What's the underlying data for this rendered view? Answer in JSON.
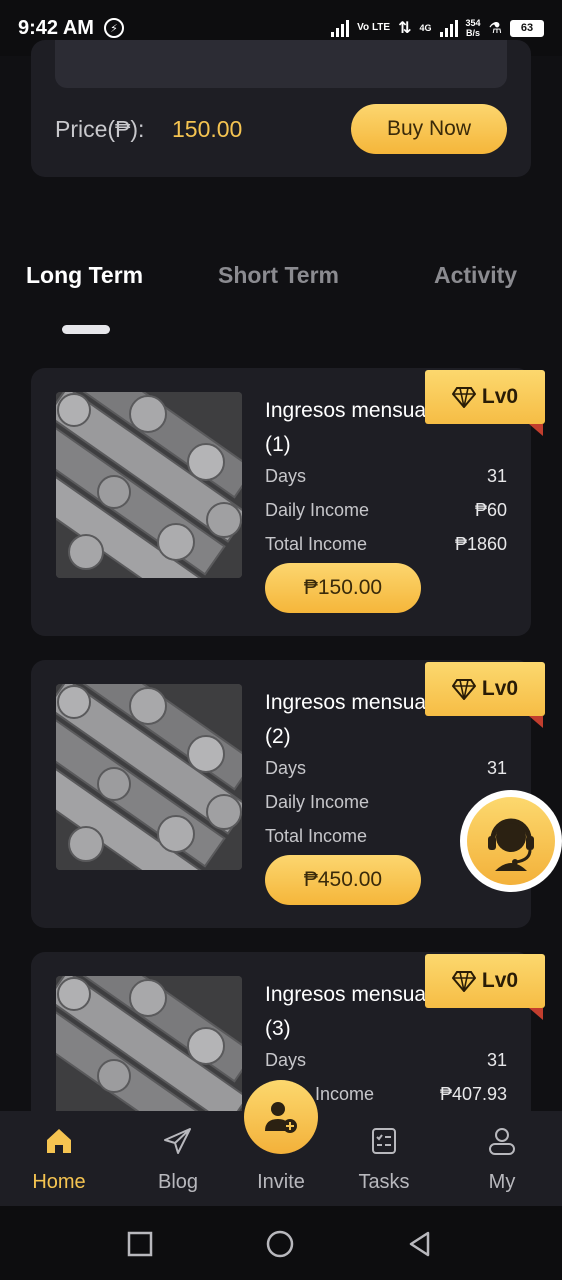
{
  "status_bar": {
    "time": "9:42 AM",
    "network_type": "Vo LTE",
    "speed_value": "354",
    "speed_unit": "B/s",
    "net_gen": "4G",
    "battery": "63"
  },
  "top_card": {
    "price_label": "Price(₱):",
    "price_value": "150.00",
    "buy_label": "Buy Now"
  },
  "tabs": [
    {
      "label": "Long Term",
      "active": true
    },
    {
      "label": "Short Term",
      "active": false
    },
    {
      "label": "Activity",
      "active": false
    }
  ],
  "products": [
    {
      "name": "Ingresos mensuales",
      "index": "(1)",
      "level": "Lv0",
      "rows": [
        {
          "label": "Days",
          "value": "31"
        },
        {
          "label": "Daily Income",
          "value": "₱60"
        },
        {
          "label": "Total Income",
          "value": "₱1860"
        }
      ],
      "price_button": "₱150.00"
    },
    {
      "name": "Ingresos mensuales",
      "index": "(2)",
      "level": "Lv0",
      "rows": [
        {
          "label": "Days",
          "value": "31"
        },
        {
          "label": "Daily Income",
          "value": "₱"
        },
        {
          "label": "Total Income",
          "value": "₱"
        }
      ],
      "price_button": "₱450.00"
    },
    {
      "name": "Ingresos mensuales",
      "index": "(3)",
      "level": "Lv0",
      "rows": [
        {
          "label": "Days",
          "value": "31"
        },
        {
          "label": "Income",
          "value": "₱407.93"
        }
      ]
    }
  ],
  "bottom_nav": [
    {
      "label": "Home",
      "icon": "home-icon",
      "active": true
    },
    {
      "label": "Blog",
      "icon": "paper-plane-icon",
      "active": false
    },
    {
      "label": "Invite",
      "icon": "add-user-icon",
      "active": false
    },
    {
      "label": "Tasks",
      "icon": "tasks-icon",
      "active": false
    },
    {
      "label": "My",
      "icon": "user-icon",
      "active": false
    }
  ],
  "colors": {
    "accent": "#f5c451",
    "background": "#101013",
    "card": "#1e1e24"
  }
}
